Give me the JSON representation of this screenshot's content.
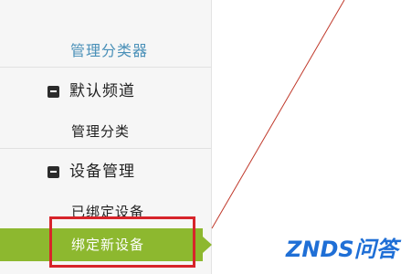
{
  "sidebar": {
    "manager_title": "管理分类器",
    "groups": [
      {
        "label": "默认频道",
        "items": [
          {
            "label": "管理分类"
          }
        ]
      },
      {
        "label": "设备管理",
        "items": [
          {
            "label": "已绑定设备"
          },
          {
            "label": "绑定新设备"
          }
        ]
      }
    ]
  },
  "watermark": {
    "text": "ZNDS问答"
  },
  "colors": {
    "active_green": "#8db82f",
    "highlight_red": "#d7242a",
    "title_blue": "#4a90b8",
    "watermark_blue": "#1f6fd6"
  },
  "icons": {
    "collapse": "minus-square-icon"
  }
}
